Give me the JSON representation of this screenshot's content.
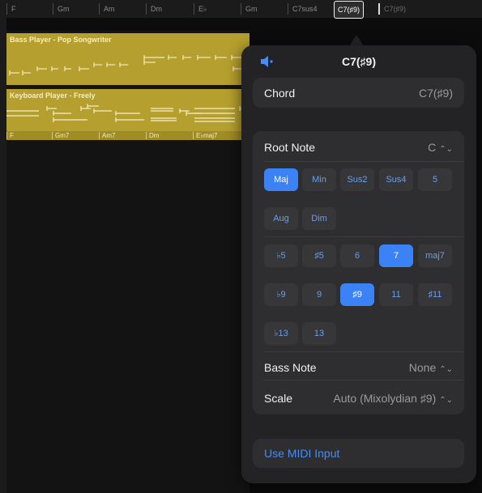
{
  "ruler": {
    "chords": [
      "F",
      "Gm",
      "Am",
      "Dm",
      "E♭",
      "Gm",
      "C7sus4",
      "C7(♯9)",
      "C7(♯9)"
    ]
  },
  "tracks": [
    {
      "name": "Bass Player - Pop Songwriter",
      "chords": []
    },
    {
      "name": "Keyboard Player - Freely",
      "chords": [
        "F",
        "Gm7",
        "Am7",
        "Dm",
        "E♭maj7"
      ]
    }
  ],
  "popover": {
    "title": "C7(♯9)",
    "chord_label": "Chord",
    "chord_value": "C7(♯9)",
    "root_note_label": "Root Note",
    "root_note_value": "C",
    "quality_buttons": [
      "Maj",
      "Min",
      "Sus2",
      "Sus4",
      "5",
      "Aug",
      "Dim"
    ],
    "selected_quality": "Maj",
    "extension_buttons_row1": [
      "♭5",
      "♯5",
      "6",
      "7",
      "maj7"
    ],
    "extension_buttons_row2": [
      "♭9",
      "9",
      "♯9",
      "11",
      "♯11"
    ],
    "extension_buttons_row3": [
      "♭13",
      "13"
    ],
    "selected_extensions": [
      "7",
      "♯9"
    ],
    "bass_note_label": "Bass Note",
    "bass_note_value": "None",
    "scale_label": "Scale",
    "scale_value": "Auto (Mixolydian ♯9)",
    "midi_label": "Use MIDI Input"
  },
  "colors": {
    "accent": "#3b82f6",
    "region": "#b59f2e",
    "popover_bg": "#232325"
  }
}
